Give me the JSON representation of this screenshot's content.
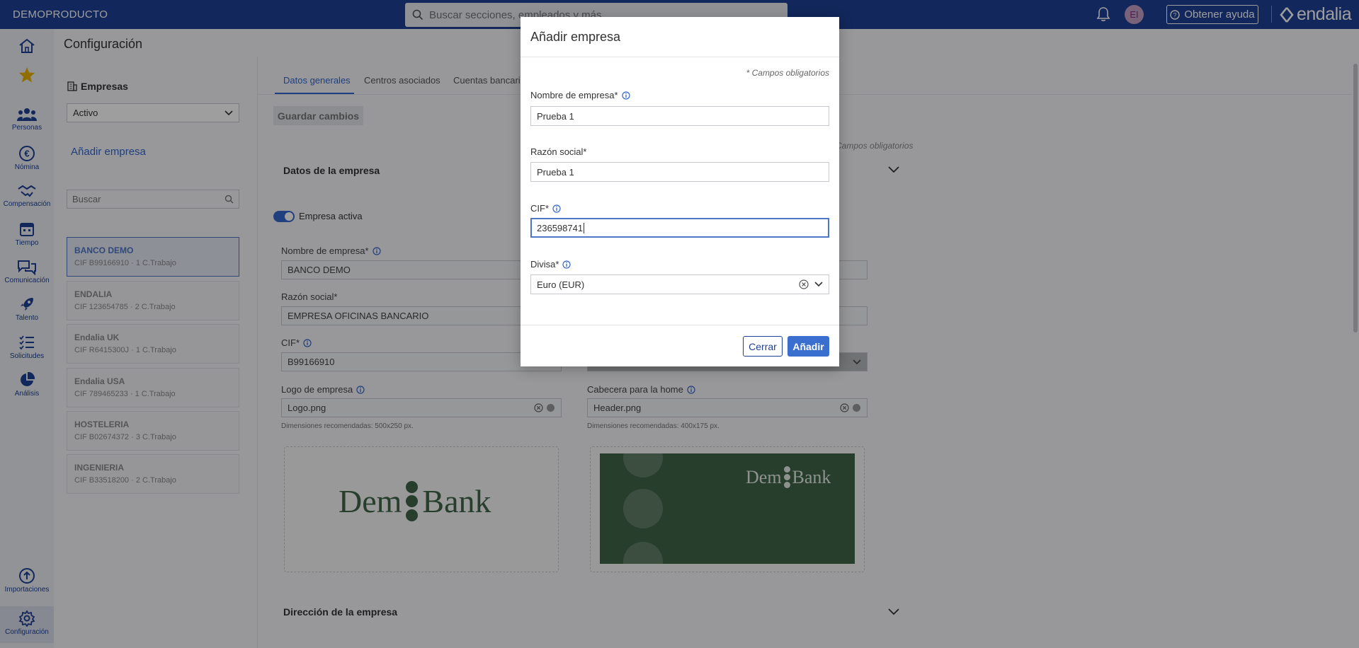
{
  "app": {
    "brand": "DEMOPRODUCTO",
    "search_placeholder": "Buscar secciones, empleados y más",
    "avatar_initials": "EI",
    "help_label": "Obtener ayuda",
    "logo_text": "endalia"
  },
  "nav": {
    "items": [
      {
        "label": ""
      },
      {
        "label": ""
      },
      {
        "label": "Personas"
      },
      {
        "label": "Nómina"
      },
      {
        "label": "Compensación"
      },
      {
        "label": "Tiempo"
      },
      {
        "label": "Comunicación"
      },
      {
        "label": "Talento"
      },
      {
        "label": "Solicitudes"
      },
      {
        "label": "Análisis"
      },
      {
        "label": "Importaciones"
      },
      {
        "label": "Configuración"
      }
    ]
  },
  "page": {
    "title": "Configuración",
    "panel_title": "Empresas",
    "status_value": "Activo",
    "add_company": "Añadir empresa",
    "search_placeholder": "Buscar",
    "companies": [
      {
        "name": "BANCO DEMO",
        "meta": "CIF B99166910 · 1 C.Trabajo"
      },
      {
        "name": "ENDALIA",
        "meta": "CIF 123654785 · 2 C.Trabajo"
      },
      {
        "name": "Endalia UK",
        "meta": "CIF R6415300J · 1 C.Trabajo"
      },
      {
        "name": "Endalia USA",
        "meta": "CIF 789465233 · 1 C.Trabajo"
      },
      {
        "name": "HOSTELERIA",
        "meta": "CIF B02674372 · 3 C.Trabajo"
      },
      {
        "name": "INGENIERIA",
        "meta": "CIF B33518200 · 2 C.Trabajo"
      }
    ]
  },
  "tabs": [
    {
      "label": "Datos generales"
    },
    {
      "label": "Centros asociados"
    },
    {
      "label": "Cuentas bancarias"
    }
  ],
  "form": {
    "save_label": "Guardar cambios",
    "required_note": "Campos obligatorios",
    "section_company": "Datos de la empresa",
    "active_label": "Empresa activa",
    "name_label": "Nombre de empresa*",
    "name_value": "BANCO DEMO",
    "legal_label": "Razón social*",
    "legal_value": "EMPRESA OFICINAS  BANCARIO",
    "cif_label": "CIF*",
    "cif_value": "B99166910",
    "logo_label": "Logo de empresa",
    "logo_value": "Logo.png",
    "logo_hint": "Dimensiones recomendadas: 500x250 px.",
    "header_label": "Cabecera para la home",
    "header_value": "Header.png",
    "header_hint": "Dimensiones recomendadas: 400x175 px.",
    "logo_image_left": "Dem",
    "logo_image_right": "Bank",
    "section_address": "Dirección de la empresa"
  },
  "modal": {
    "title": "Añadir empresa",
    "required_note": "* Campos obligatorios",
    "name_label": "Nombre de empresa*",
    "name_value": "Prueba 1",
    "legal_label": "Razón social*",
    "legal_value": "Prueba 1",
    "cif_label": "CIF*",
    "cif_value": "236598741",
    "currency_label": "Divisa*",
    "currency_value": "Euro (EUR)",
    "close_label": "Cerrar",
    "add_label": "Añadir"
  },
  "colors": {
    "topbar": "#1e3f93",
    "accent": "#3366cc",
    "primary_button": "#3a6fcf"
  }
}
